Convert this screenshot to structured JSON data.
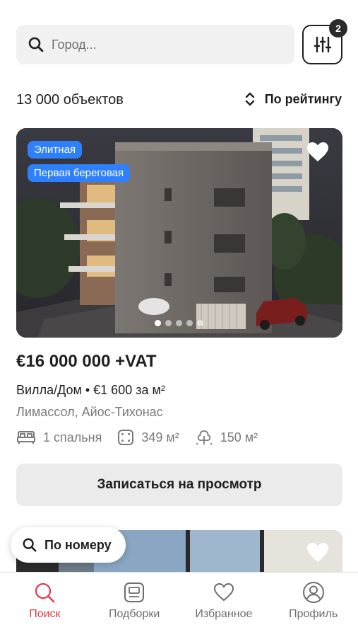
{
  "search": {
    "placeholder": "Город...",
    "value": "",
    "filter_badge_count": "2"
  },
  "results": {
    "count_text": "13 000 объектов",
    "sort_label": "По рейтингу"
  },
  "listing": {
    "tags": [
      "Элитная",
      "Первая береговая"
    ],
    "carousel_total": 5,
    "carousel_active": 1,
    "price": "€16 000 000 +VAT",
    "type_line": "Вилла/Дом • €1 600 за м²",
    "location": "Лимассол, Айос-Тихонас",
    "features": {
      "bedrooms": "1 спальня",
      "area": "349 м²",
      "plot": "150 м²"
    },
    "book_button": "Записаться на просмотр"
  },
  "floating": {
    "by_number": "По номеру"
  },
  "nav": {
    "items": [
      {
        "label": "Поиск",
        "icon": "search-icon",
        "active": true
      },
      {
        "label": "Подборки",
        "icon": "collections-icon",
        "active": false
      },
      {
        "label": "Избранное",
        "icon": "heart-icon",
        "active": false
      },
      {
        "label": "Профиль",
        "icon": "profile-icon",
        "active": false
      }
    ]
  },
  "colors": {
    "accent": "#e53945",
    "tag_blue": "#2f80ff",
    "text": "#1f1f1f",
    "muted": "#7a7a7a"
  }
}
